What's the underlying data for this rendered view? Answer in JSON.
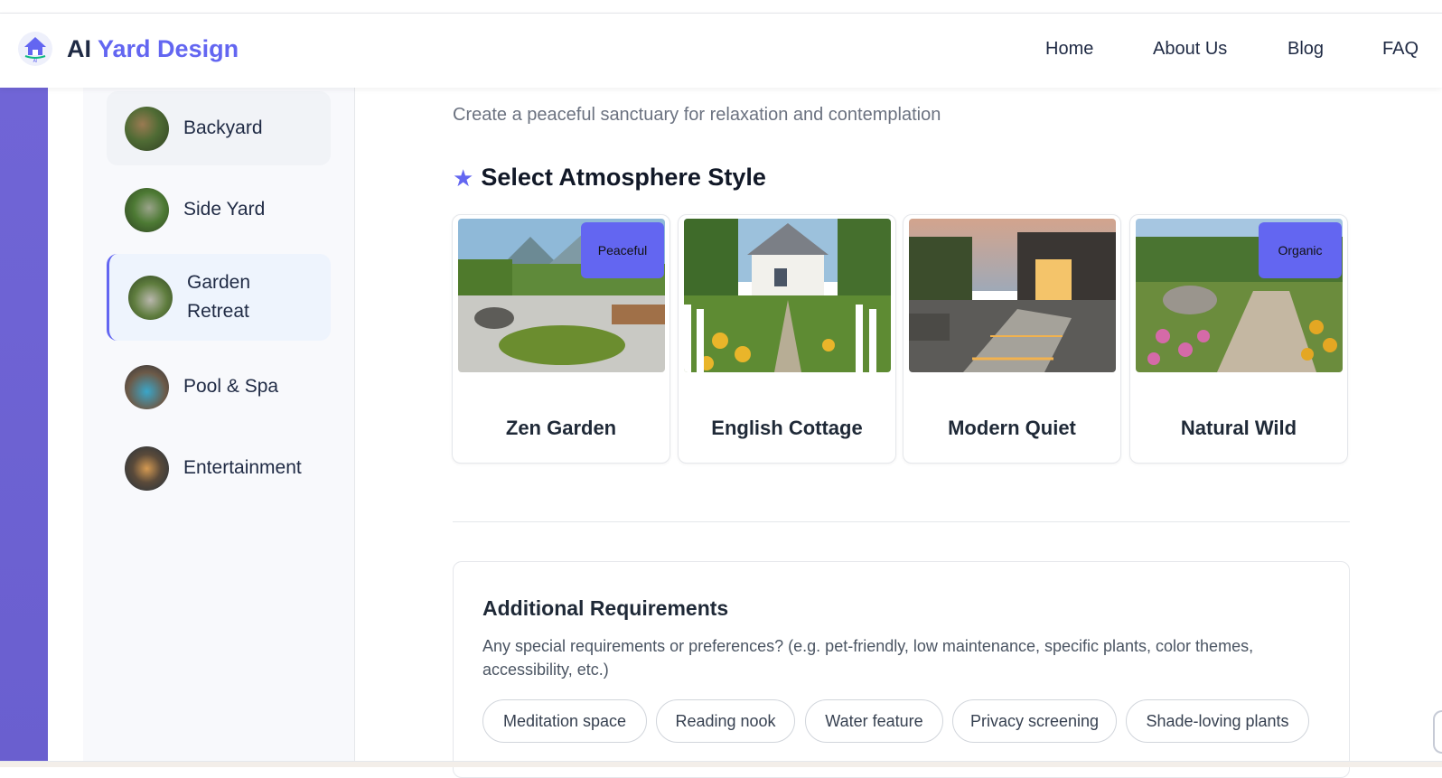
{
  "header": {
    "logo_part1": "AI ",
    "logo_part2": "Yard Design",
    "nav": [
      "Home",
      "About Us",
      "Blog",
      "FAQ"
    ]
  },
  "sidebar": {
    "items": [
      {
        "label": "Backyard",
        "state": "hover"
      },
      {
        "label": "Side Yard",
        "state": "normal"
      },
      {
        "label": "Garden Retreat",
        "state": "active"
      },
      {
        "label": "Pool & Spa",
        "state": "normal"
      },
      {
        "label": "Entertainment",
        "state": "normal"
      }
    ]
  },
  "main": {
    "subtitle": "Create a peaceful sanctuary for relaxation and contemplation",
    "section_title": "Select Atmosphere Style",
    "cards": [
      {
        "name": "Zen Garden",
        "tag": "Peaceful"
      },
      {
        "name": "English Cottage",
        "tag": ""
      },
      {
        "name": "Modern Quiet",
        "tag": ""
      },
      {
        "name": "Natural Wild",
        "tag": "Organic"
      }
    ],
    "requirements": {
      "title": "Additional Requirements",
      "description": "Any special requirements or preferences? (e.g. pet-friendly, low maintenance, specific plants, color themes, accessibility, etc.)",
      "chips": [
        "Meditation space",
        "Reading nook",
        "Water feature",
        "Privacy screening",
        "Shade-loving plants"
      ]
    }
  },
  "colors": {
    "accent": "#6366f1",
    "sidebar_band": "#7065d6",
    "active_bg": "#eef4fd"
  }
}
